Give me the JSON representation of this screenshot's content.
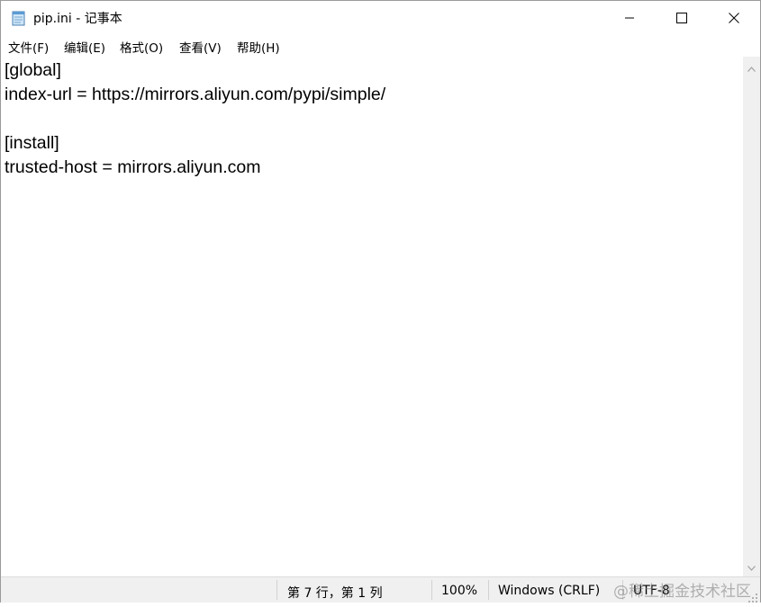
{
  "window": {
    "title": "pip.ini - 记事本",
    "app_icon": "notepad-icon",
    "controls": {
      "minimize": "minimize-icon",
      "maximize": "maximize-icon",
      "close": "close-icon"
    }
  },
  "menu": {
    "items": [
      {
        "label": "文件(F)"
      },
      {
        "label": "编辑(E)"
      },
      {
        "label": "格式(O)"
      },
      {
        "label": "查看(V)"
      },
      {
        "label": "帮助(H)"
      }
    ]
  },
  "editor": {
    "content": "[global]\nindex-url = https://mirrors.aliyun.com/pypi/simple/\n\n[install]\ntrusted-host = mirrors.aliyun.com"
  },
  "status": {
    "position": "第 7 行，第 1 列",
    "zoom": "100%",
    "line_ending": "Windows (CRLF)",
    "encoding": "UTF-8"
  },
  "watermark": "@稀土掘金技术社区",
  "colors": {
    "statusbar_bg": "#f0f0f0",
    "scrollbar_bg": "#f0f0f0"
  }
}
